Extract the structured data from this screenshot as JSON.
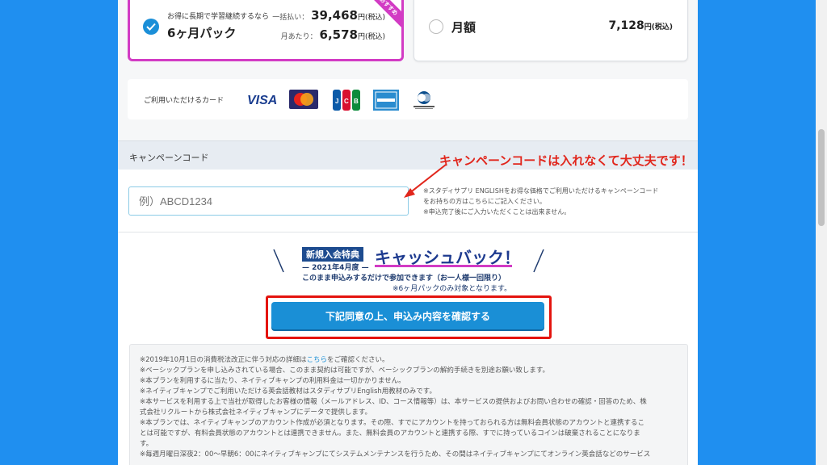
{
  "plans": {
    "six_month": {
      "subtitle": "お得に長期で学習継続するなら",
      "name": "6ヶ月パック",
      "lump_label": "一括払い：",
      "lump_price": "39,468",
      "lump_unit": "円(税込)",
      "monthly_label": "月あたり：",
      "monthly_price": "6,578",
      "monthly_unit": "円(税込)",
      "ribbon": "おすすめ",
      "selected": true
    },
    "monthly": {
      "name": "月額",
      "price": "7,128",
      "unit": "円(税込)",
      "selected": false
    }
  },
  "cards": {
    "label": "ご利用いただけるカード",
    "brands": [
      "VISA",
      "MasterCard",
      "JCB",
      "AMERICAN EXPRESS",
      "Diners Club International"
    ]
  },
  "campaign": {
    "title": "キャンペーンコード",
    "placeholder": "例）ABCD1234",
    "note_lines": [
      "※スタディサプリ ENGLISHをお得な価格でご利用いただけるキャンペーンコード",
      "をお持ちの方はこちらにご記入ください。",
      "※申込完了後にご入力いただくことは出来ません。"
    ]
  },
  "annotation": {
    "text": "キャンペーンコードは入れなくて大丈夫です！",
    "color": "#e1261c"
  },
  "cashback": {
    "chip": "新規入会特典",
    "year": "— 2021年4月度 —",
    "title": "キャッシュバック！",
    "line1": "このまま申込みするだけで参加できます（お一人様一回限り）",
    "line2": "※6ヶ月パックのみ対象となります。"
  },
  "confirm_button": "下記同意の上、申込み内容を確認する",
  "notice": {
    "line1_pre": "※2019年10月1日の消費税法改正に伴う対応の詳細は",
    "line1_link": "こちら",
    "line1_post": "をご確認ください。",
    "lines": [
      "※ベーシックプランを申し込みされている場合、このまま契約は可能ですが、ベーシックプランの解約手続きを別途お願い致します。",
      "※本プランを利用するに当たり、ネイティブキャンプの利用料金は一切かかりません。",
      "※ネイティブキャンプでご利用いただける英会話教材はスタディサプリEnglish用教材のみです。",
      "※本サービスを利用する上で当社が取得したお客様の情報（メールアドレス、ID、コース情報等）は、本サービスの提供およびお問い合わせの確認・回答のため、株",
      "式会社リクルートから株式会社ネイティブキャンプにデータで提供します。",
      "※本プランでは、ネイティブキャンプのアカウント作成が必須となります。その際、すでにアカウントを持っておられる方は無料会員状態のアカウントと連携するこ",
      "とは可能ですが、有料会員状態のアカウントとは連携できません。また、無料会員のアカウントと連携する際、すでに持っているコインは破棄されることになりま",
      "す。",
      "※毎週月曜日深夜2：00〜早朝6：00にネイティブキャンプにてシステムメンテナンスを行うため、その間はネイティブキャンプにてオンライン英会話などのサービス"
    ]
  },
  "colors": {
    "background": "#1f8ff0",
    "accent_pink": "#d23bc4",
    "primary_blue": "#1a8fd6",
    "highlight_red": "#e4140e"
  }
}
